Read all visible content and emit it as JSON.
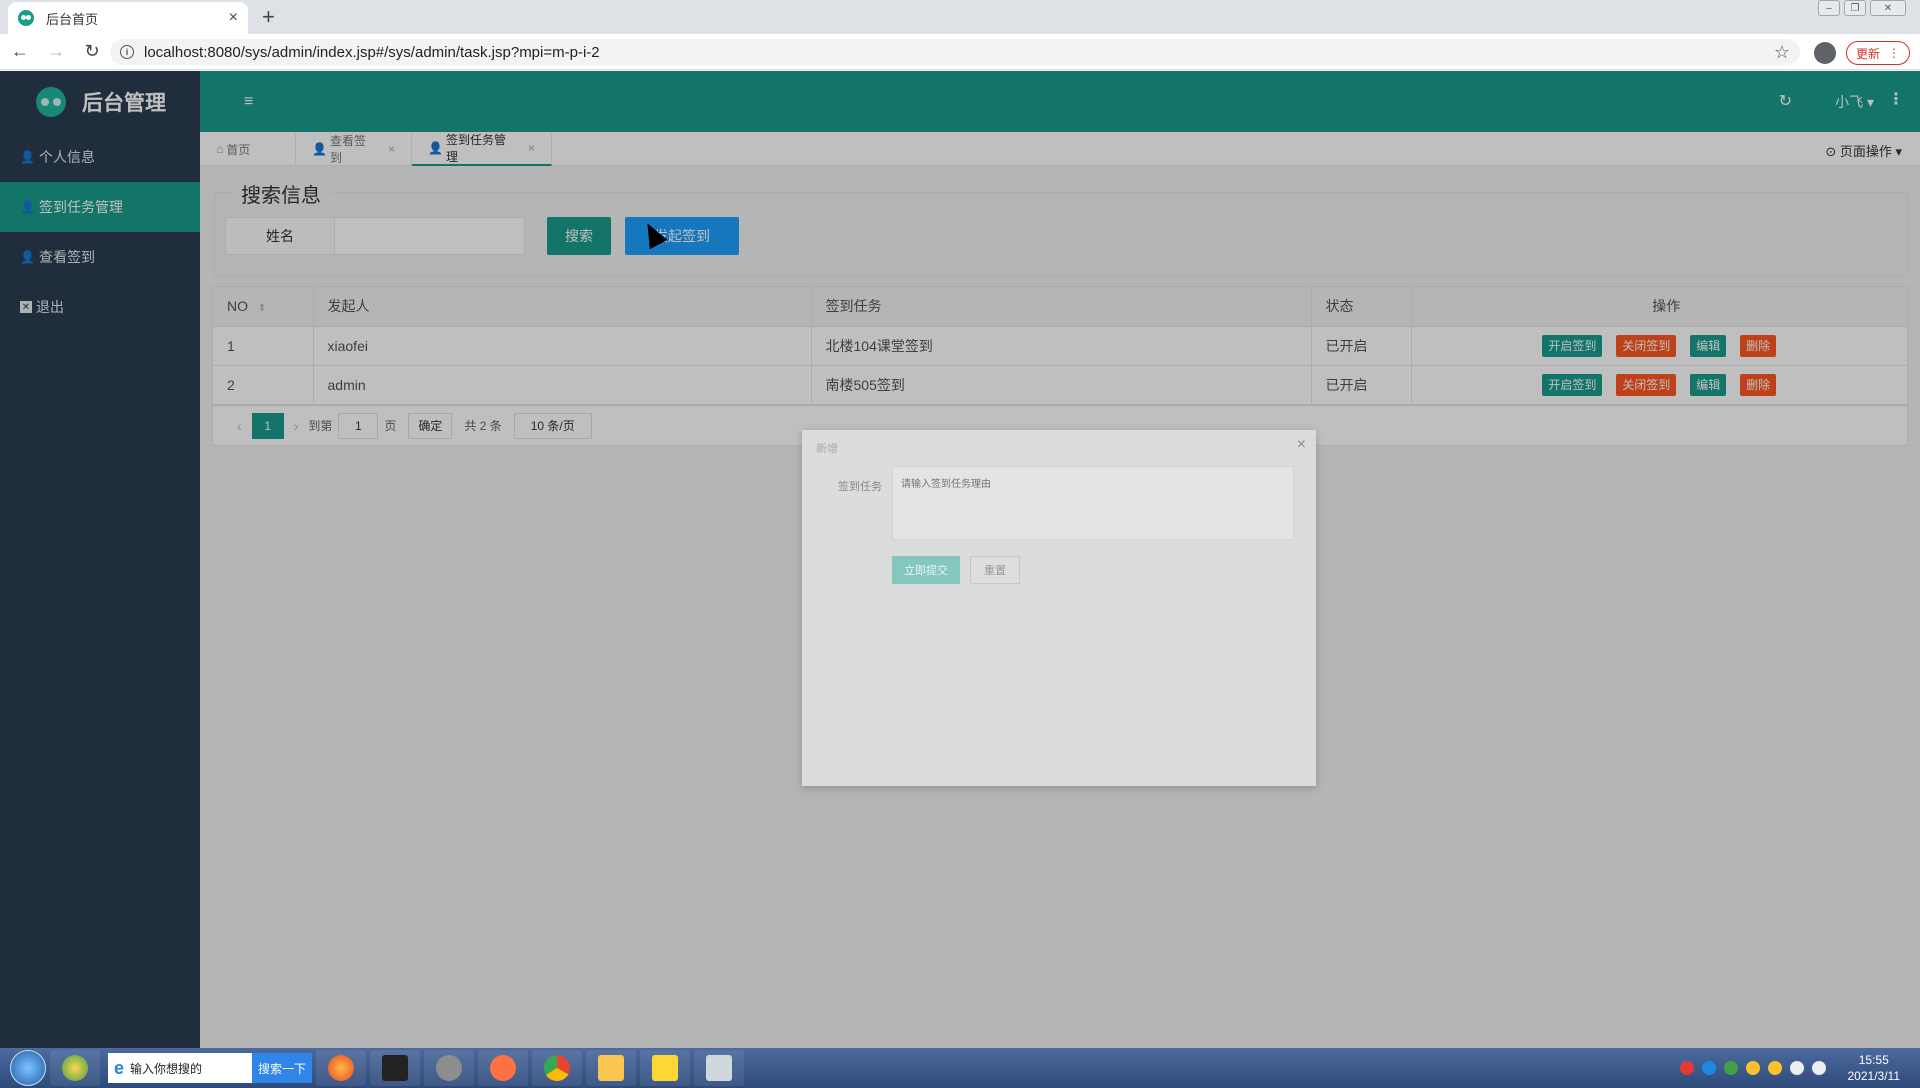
{
  "browser": {
    "tab_title": "后台首页",
    "tab_close": "×",
    "new_tab": "+",
    "url": "localhost:8080/sys/admin/index.jsp#/sys/admin/task.jsp?mpi=m-p-i-2",
    "update_label": "更新",
    "update_menu": "⋮",
    "nav_back": "←",
    "nav_forward": "→",
    "nav_reload": "↻",
    "star": "☆",
    "win_min": "–",
    "win_max": "❐",
    "win_close": "✕"
  },
  "header": {
    "logo_text": "后台管理",
    "menu_toggle": "≡",
    "refresh": "↻",
    "user": "小飞 ▾",
    "more": "⋮"
  },
  "sidebar": {
    "items": [
      {
        "icon": "👤",
        "label": "个人信息"
      },
      {
        "icon": "👤",
        "label": "签到任务管理"
      },
      {
        "icon": "👤",
        "label": "查看签到"
      },
      {
        "icon": "✕",
        "label": "退出"
      }
    ]
  },
  "page_tabs": {
    "tabs": [
      {
        "label": "首页"
      },
      {
        "label": "查看签到"
      },
      {
        "label": "签到任务管理"
      }
    ],
    "close": "×",
    "home_icon": "⌂",
    "user_icon": "👤",
    "ops": "⊙ 页面操作 ▾"
  },
  "search": {
    "legend": "搜索信息",
    "name_label": "姓名",
    "name_value": "",
    "search_btn": "搜索",
    "launch_btn": "发起签到"
  },
  "table": {
    "headers": [
      "NO",
      "发起人",
      "签到任务",
      "状态",
      "操作"
    ],
    "sort_icon": "⬍",
    "rows": [
      {
        "no": "1",
        "initiator": "xiaofei",
        "task": "北楼104课堂签到",
        "status": "已开启"
      },
      {
        "no": "2",
        "initiator": "admin",
        "task": "南楼505签到",
        "status": "已开启"
      }
    ],
    "actions": {
      "open": "开启签到",
      "close": "关闭签到",
      "edit": "编辑",
      "delete": "删除"
    }
  },
  "pager": {
    "prev": "‹",
    "current": "1",
    "next": "›",
    "goto": "到第",
    "page_input": "1",
    "page_unit": "页",
    "confirm": "确定",
    "total": "共 2 条",
    "page_size": "10 条/页"
  },
  "modal": {
    "title": "新增",
    "close": "×",
    "label": "签到任务",
    "placeholder": "请输入签到任务理由",
    "submit": "立即提交",
    "reset": "重置"
  },
  "taskbar": {
    "search_icon": "e",
    "search_text": "输入你想搜的",
    "search_btn": "搜索一下",
    "time": "15:55",
    "date": "2021/3/11"
  },
  "colors": {
    "primary": "#1a9c8d",
    "sidebar": "#2b3c52",
    "blue": "#1e9fff",
    "danger": "#ff5722"
  }
}
